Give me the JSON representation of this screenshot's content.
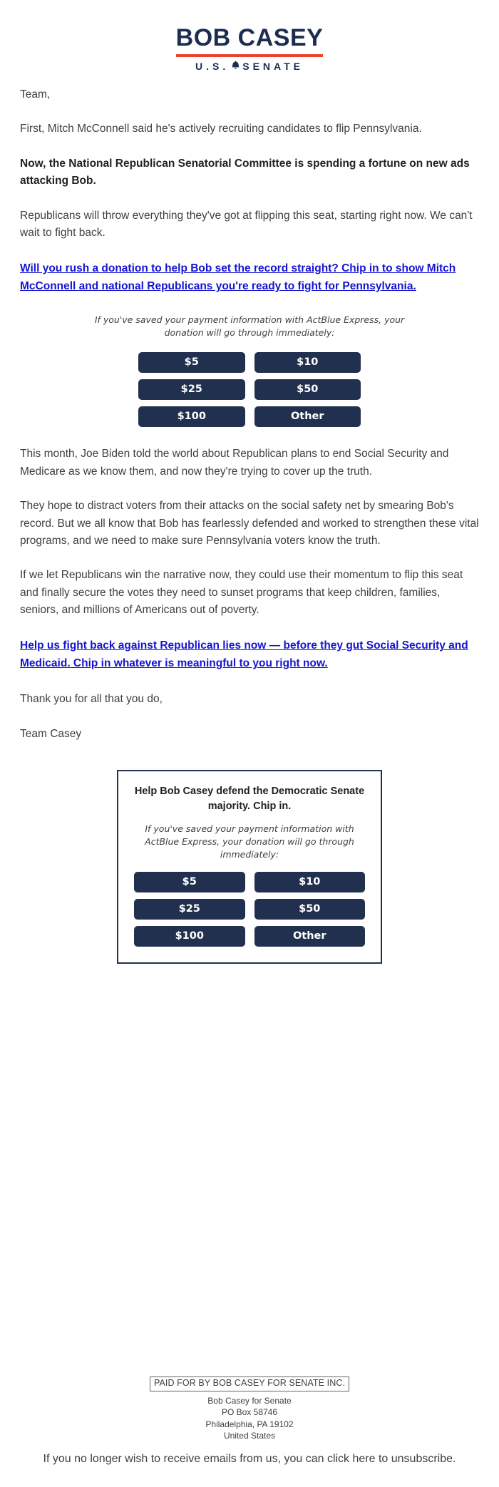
{
  "header": {
    "logo_name": "BOB CASEY",
    "logo_subtitle_left": "U.S.",
    "logo_subtitle_icon": "liberty-bell-icon",
    "logo_subtitle_right": "SENATE",
    "accent_red": "#e8452c",
    "brand_navy": "#1d2d50"
  },
  "body": {
    "salutation": "Team,",
    "para_1": "First, Mitch McConnell said he's actively recruiting candidates to flip Pennsylvania.",
    "para_2_bold": "Now, the National Republican Senatorial Committee is spending a fortune on new ads attacking Bob.",
    "para_3": "Republicans will throw everything they've got at flipping this seat, starting right now. We can't wait to fight back.",
    "link_1": "Will you rush a donation to help Bob set the record straight? Chip in to show Mitch McConnell and national Republicans you're ready to fight for Pennsylvania.",
    "express_note": "If you've saved your payment information with ActBlue Express, your donation will go through immediately:",
    "para_4": "This month, Joe Biden told the world about Republican plans to end Social Security and Medicare as we know them, and now they're trying to cover up the truth.",
    "para_5": "They hope to distract voters from their attacks on the social safety net by smearing Bob's record. But we all know that Bob has fearlessly defended and worked to strengthen these vital programs, and we need to make sure Pennsylvania voters know the truth.",
    "para_6": "If we let Republicans win the narrative now, they could use their momentum to flip this seat and finally secure the votes they need to sunset programs that keep children, families, seniors, and millions of Americans out of poverty.",
    "link_2": "Help us fight back against Republican lies now — before they gut Social Security and Medicaid. Chip in whatever is meaningful to you right now.",
    "closing": "Thank you for all that you do,",
    "signature": "Team Casey"
  },
  "donate": {
    "button_color": "#22304f",
    "amounts": [
      {
        "label": "$5"
      },
      {
        "label": "$10"
      },
      {
        "label": "$25"
      },
      {
        "label": "$50"
      },
      {
        "label": "$100"
      },
      {
        "label": "Other"
      }
    ]
  },
  "ask_box": {
    "title": "Help Bob Casey defend the Democratic Senate majority. Chip in.",
    "express_note": "If you've saved your payment information with ActBlue Express, your donation will go through immediately:",
    "amounts": [
      {
        "label": "$5"
      },
      {
        "label": "$10"
      },
      {
        "label": "$25"
      },
      {
        "label": "$50"
      },
      {
        "label": "$100"
      },
      {
        "label": "Other"
      }
    ]
  },
  "footer": {
    "paid_for": "PAID FOR BY BOB CASEY FOR SENATE INC.",
    "org": "Bob Casey for Senate",
    "po_box": "PO Box 58746",
    "city_state_zip": "Philadelphia, PA 19102",
    "country": "United States",
    "unsubscribe": "If you no longer wish to receive emails from us, you can click here to unsubscribe."
  }
}
